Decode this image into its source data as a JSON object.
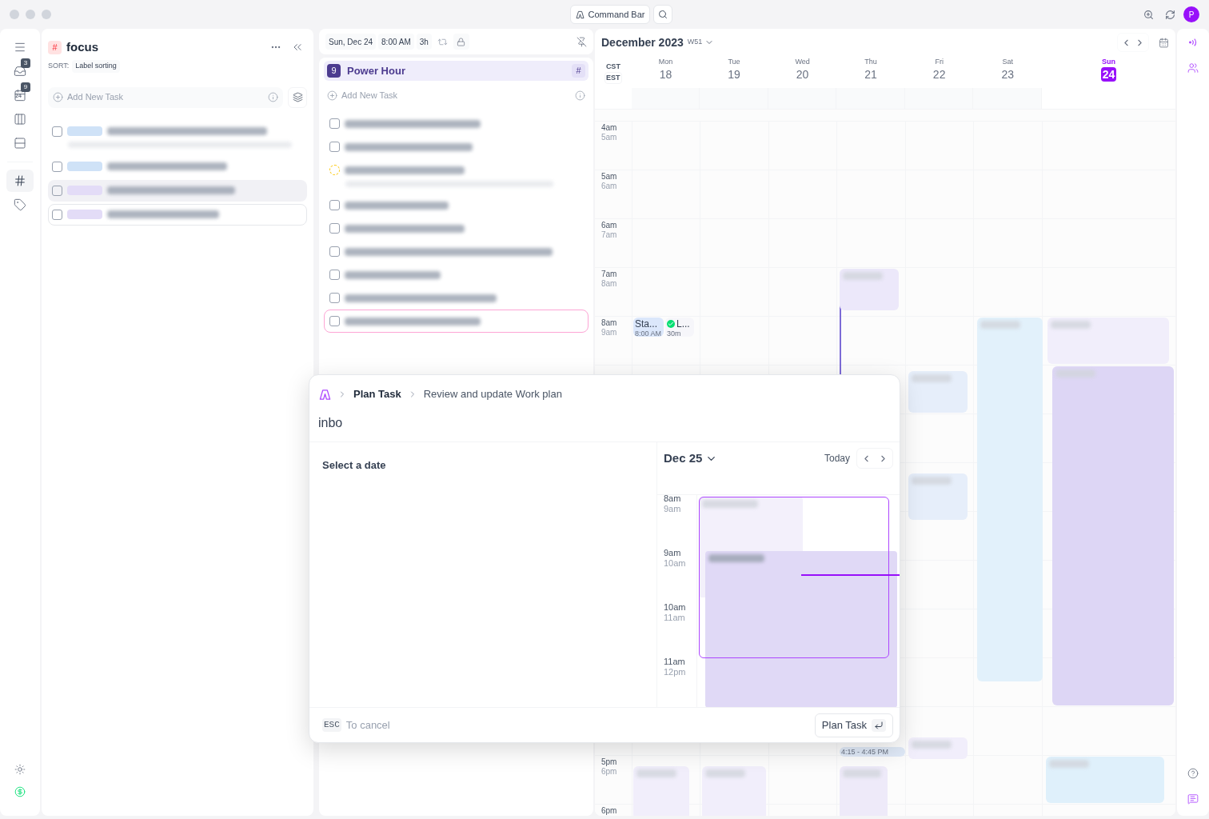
{
  "window": {
    "command_bar": "Command Bar",
    "avatar": "P"
  },
  "rail": {
    "items": [
      {
        "kind": "menu",
        "selected": false
      },
      {
        "kind": "inbox",
        "badge": "3",
        "selected": false
      },
      {
        "kind": "calendar",
        "badge": "9",
        "day": "24",
        "selected": false
      },
      {
        "kind": "board",
        "selected": false
      },
      {
        "kind": "rows",
        "selected": false
      },
      {
        "kind": "hash",
        "selected": true
      },
      {
        "kind": "tag",
        "selected": false
      }
    ],
    "bottom": [
      {
        "kind": "sun"
      },
      {
        "kind": "dollar"
      }
    ]
  },
  "focus": {
    "badge": "#",
    "title": "focus",
    "sort_label": "SORT:",
    "sort_value": "Label sorting",
    "add_placeholder": "Add New Task",
    "tasks": [
      {
        "color": "#cfe2f7",
        "note": true,
        "selected": false,
        "outlined": false
      },
      {
        "color": "#cfe2f7",
        "note": false,
        "selected": false,
        "outlined": false
      },
      {
        "color": "#e3dcf7",
        "note": false,
        "selected": true,
        "outlined": false
      },
      {
        "color": "#e3dcf7",
        "note": false,
        "selected": false,
        "outlined": true
      }
    ]
  },
  "plan": {
    "date": "Sun, Dec 24",
    "time": "8:00 AM",
    "duration": "3h",
    "count": "9",
    "title": "Power Hour",
    "badge": "#",
    "add_placeholder": "Add New Task",
    "tasks": [
      {
        "kind": "todo",
        "note": false,
        "selected": false
      },
      {
        "kind": "todo",
        "note": false,
        "selected": false
      },
      {
        "kind": "recurring",
        "note": true,
        "selected": false
      },
      {
        "kind": "todo",
        "note": false,
        "selected": false
      },
      {
        "kind": "todo",
        "note": false,
        "selected": false
      },
      {
        "kind": "todo",
        "note": false,
        "selected": false
      },
      {
        "kind": "todo",
        "note": false,
        "selected": false
      },
      {
        "kind": "todo",
        "note": false,
        "selected": false
      },
      {
        "kind": "todo",
        "note": false,
        "selected": true
      }
    ]
  },
  "calendar": {
    "month": "December 2023",
    "week": "W51",
    "timezones": [
      "CST",
      "EST"
    ],
    "days": [
      {
        "dow": "Mon",
        "date": "18",
        "today": false
      },
      {
        "dow": "Tue",
        "date": "19",
        "today": false
      },
      {
        "dow": "Wed",
        "date": "20",
        "today": false
      },
      {
        "dow": "Thu",
        "date": "21",
        "today": false
      },
      {
        "dow": "Fri",
        "date": "22",
        "today": false
      },
      {
        "dow": "Sat",
        "date": "23",
        "today": false
      },
      {
        "dow": "Sun",
        "date": "24",
        "today": true
      }
    ],
    "hours": [
      {
        "kind": "label",
        "primary": "4am",
        "secondary": "5am"
      },
      {
        "kind": "label",
        "primary": "5am",
        "secondary": "6am"
      },
      {
        "kind": "label",
        "primary": "6am",
        "secondary": "7am"
      },
      {
        "kind": "label",
        "primary": "7am",
        "secondary": "8am"
      },
      {
        "kind": "label",
        "primary": "8am",
        "secondary": "9am"
      },
      {
        "kind": "covered"
      },
      {
        "kind": "covered"
      },
      {
        "kind": "covered"
      },
      {
        "kind": "covered"
      },
      {
        "kind": "covered"
      },
      {
        "kind": "covered"
      },
      {
        "kind": "covered"
      },
      {
        "kind": "covered"
      },
      {
        "kind": "label",
        "primary": "5pm",
        "secondary": "6pm"
      },
      {
        "kind": "label",
        "primary": "6pm"
      }
    ],
    "events": [
      {
        "kind": "text",
        "title": "Sta...",
        "time": "8:00 AM",
        "color": "#dbe7fb"
      },
      {
        "kind": "done",
        "title": "L...",
        "time": "30m",
        "color": "#f6f6fa"
      },
      {
        "kind": "text",
        "time": "4:15 - 4:45 PM",
        "color": "#dfe9f7"
      },
      {
        "kind": "blurred",
        "color": "#ece8fa"
      },
      {
        "kind": "blurred",
        "color": "#e2f1fb"
      },
      {
        "kind": "blurred",
        "color": "#f1eefb"
      },
      {
        "kind": "blurred",
        "color": "#ddd6f5"
      },
      {
        "kind": "blurred",
        "color": "#eeeaf9"
      },
      {
        "kind": "blurred",
        "color": "#e6eefa"
      },
      {
        "kind": "blurred",
        "color": "#e6eefa"
      },
      {
        "kind": "blurred",
        "color": "#f1eefb"
      },
      {
        "kind": "blurred",
        "color": "#f1eefb"
      },
      {
        "kind": "blurred",
        "color": "#f1eefb"
      },
      {
        "kind": "blurred",
        "color": "#dff0fb"
      }
    ]
  },
  "dialog": {
    "crumbs": [
      "Plan Task",
      "Review and update Work plan"
    ],
    "value": "inbo",
    "prompt": "Select a date",
    "day": "Dec 25",
    "today": "Today",
    "hours": [
      {
        "primary": "8am",
        "secondary": "9am"
      },
      {
        "primary": "9am",
        "secondary": "10am"
      },
      {
        "primary": "10am",
        "secondary": "11am"
      },
      {
        "primary": "11am",
        "secondary": "12pm"
      }
    ],
    "esc_key": "ESC",
    "esc_hint": "To cancel",
    "submit": "Plan Task"
  }
}
